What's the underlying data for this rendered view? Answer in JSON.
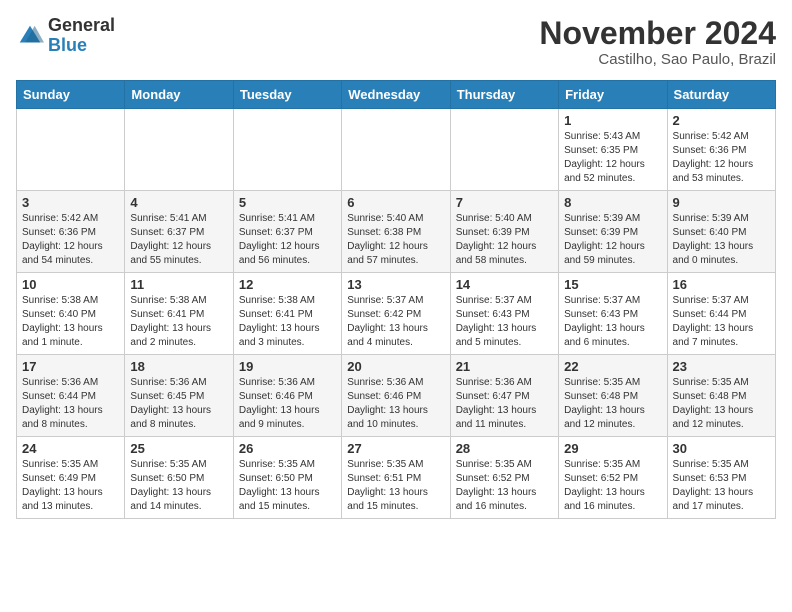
{
  "header": {
    "logo": {
      "general": "General",
      "blue": "Blue"
    },
    "title": "November 2024",
    "location": "Castilho, Sao Paulo, Brazil"
  },
  "weekdays": [
    "Sunday",
    "Monday",
    "Tuesday",
    "Wednesday",
    "Thursday",
    "Friday",
    "Saturday"
  ],
  "weeks": [
    [
      null,
      null,
      null,
      null,
      null,
      {
        "day": "1",
        "sunrise": "5:43 AM",
        "sunset": "6:35 PM",
        "daylight": "12 hours and 52 minutes."
      },
      {
        "day": "2",
        "sunrise": "5:42 AM",
        "sunset": "6:36 PM",
        "daylight": "12 hours and 53 minutes."
      }
    ],
    [
      {
        "day": "3",
        "sunrise": "5:42 AM",
        "sunset": "6:36 PM",
        "daylight": "12 hours and 54 minutes."
      },
      {
        "day": "4",
        "sunrise": "5:41 AM",
        "sunset": "6:37 PM",
        "daylight": "12 hours and 55 minutes."
      },
      {
        "day": "5",
        "sunrise": "5:41 AM",
        "sunset": "6:37 PM",
        "daylight": "12 hours and 56 minutes."
      },
      {
        "day": "6",
        "sunrise": "5:40 AM",
        "sunset": "6:38 PM",
        "daylight": "12 hours and 57 minutes."
      },
      {
        "day": "7",
        "sunrise": "5:40 AM",
        "sunset": "6:39 PM",
        "daylight": "12 hours and 58 minutes."
      },
      {
        "day": "8",
        "sunrise": "5:39 AM",
        "sunset": "6:39 PM",
        "daylight": "12 hours and 59 minutes."
      },
      {
        "day": "9",
        "sunrise": "5:39 AM",
        "sunset": "6:40 PM",
        "daylight": "13 hours and 0 minutes."
      }
    ],
    [
      {
        "day": "10",
        "sunrise": "5:38 AM",
        "sunset": "6:40 PM",
        "daylight": "13 hours and 1 minute."
      },
      {
        "day": "11",
        "sunrise": "5:38 AM",
        "sunset": "6:41 PM",
        "daylight": "13 hours and 2 minutes."
      },
      {
        "day": "12",
        "sunrise": "5:38 AM",
        "sunset": "6:41 PM",
        "daylight": "13 hours and 3 minutes."
      },
      {
        "day": "13",
        "sunrise": "5:37 AM",
        "sunset": "6:42 PM",
        "daylight": "13 hours and 4 minutes."
      },
      {
        "day": "14",
        "sunrise": "5:37 AM",
        "sunset": "6:43 PM",
        "daylight": "13 hours and 5 minutes."
      },
      {
        "day": "15",
        "sunrise": "5:37 AM",
        "sunset": "6:43 PM",
        "daylight": "13 hours and 6 minutes."
      },
      {
        "day": "16",
        "sunrise": "5:37 AM",
        "sunset": "6:44 PM",
        "daylight": "13 hours and 7 minutes."
      }
    ],
    [
      {
        "day": "17",
        "sunrise": "5:36 AM",
        "sunset": "6:44 PM",
        "daylight": "13 hours and 8 minutes."
      },
      {
        "day": "18",
        "sunrise": "5:36 AM",
        "sunset": "6:45 PM",
        "daylight": "13 hours and 8 minutes."
      },
      {
        "day": "19",
        "sunrise": "5:36 AM",
        "sunset": "6:46 PM",
        "daylight": "13 hours and 9 minutes."
      },
      {
        "day": "20",
        "sunrise": "5:36 AM",
        "sunset": "6:46 PM",
        "daylight": "13 hours and 10 minutes."
      },
      {
        "day": "21",
        "sunrise": "5:36 AM",
        "sunset": "6:47 PM",
        "daylight": "13 hours and 11 minutes."
      },
      {
        "day": "22",
        "sunrise": "5:35 AM",
        "sunset": "6:48 PM",
        "daylight": "13 hours and 12 minutes."
      },
      {
        "day": "23",
        "sunrise": "5:35 AM",
        "sunset": "6:48 PM",
        "daylight": "13 hours and 12 minutes."
      }
    ],
    [
      {
        "day": "24",
        "sunrise": "5:35 AM",
        "sunset": "6:49 PM",
        "daylight": "13 hours and 13 minutes."
      },
      {
        "day": "25",
        "sunrise": "5:35 AM",
        "sunset": "6:50 PM",
        "daylight": "13 hours and 14 minutes."
      },
      {
        "day": "26",
        "sunrise": "5:35 AM",
        "sunset": "6:50 PM",
        "daylight": "13 hours and 15 minutes."
      },
      {
        "day": "27",
        "sunrise": "5:35 AM",
        "sunset": "6:51 PM",
        "daylight": "13 hours and 15 minutes."
      },
      {
        "day": "28",
        "sunrise": "5:35 AM",
        "sunset": "6:52 PM",
        "daylight": "13 hours and 16 minutes."
      },
      {
        "day": "29",
        "sunrise": "5:35 AM",
        "sunset": "6:52 PM",
        "daylight": "13 hours and 16 minutes."
      },
      {
        "day": "30",
        "sunrise": "5:35 AM",
        "sunset": "6:53 PM",
        "daylight": "13 hours and 17 minutes."
      }
    ]
  ]
}
